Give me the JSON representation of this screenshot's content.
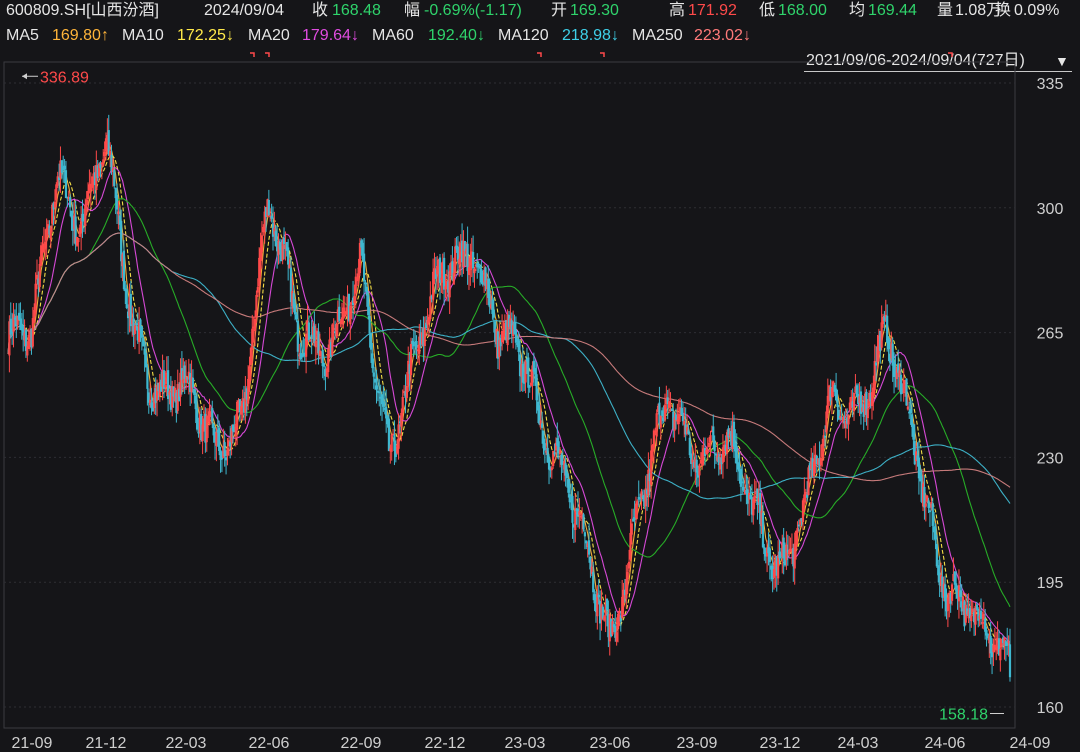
{
  "header": {
    "symbol": "600809.SH[山西汾酒]",
    "date": "2024/09/04",
    "close_label": "收",
    "close_value": "168.48",
    "change_label": "幅",
    "change_value": "-0.69%(-1.17)",
    "open_label": "开",
    "open_value": "169.30",
    "high_label": "高",
    "high_value": "171.92",
    "low_label": "低",
    "low_value": "168.00",
    "avg_label": "均",
    "avg_value": "169.44",
    "vol_label": "量",
    "vol_value": "1.08万",
    "turnover_label": "换",
    "turnover_value": "0.09%"
  },
  "legend": {
    "ma5_label": "MA5",
    "ma5_value": "169.80↑",
    "ma10_label": "MA10",
    "ma10_value": "172.25↓",
    "ma20_label": "MA20",
    "ma20_value": "179.64↓",
    "ma60_label": "MA60",
    "ma60_value": "192.40↓",
    "ma120_label": "MA120",
    "ma120_value": "218.98↓",
    "ma250_label": "MA250",
    "ma250_value": "223.02↓",
    "range_text": "2021/09/06-2024/09/04(727日)",
    "range_dropdown_icon": "triangle-down-icon"
  },
  "colors": {
    "background": "#151518",
    "up": "#ff4a4a",
    "down": "#2fd36b",
    "ma5": "#ffb43a",
    "ma10": "#ffe94a",
    "ma20": "#e04ce0",
    "ma60": "#28b428",
    "ma120": "#3fb8d0",
    "ma250": "#d08080",
    "grid": "#2e2e33",
    "axis_text": "#cfcfcf"
  },
  "chart_data": {
    "type": "candlestick",
    "title": "600809.SH[山西汾酒]",
    "ylim": [
      155,
      340
    ],
    "y_ticks": [
      160,
      195,
      230,
      265,
      300,
      335
    ],
    "x_ticks": [
      "21-09",
      "21-12",
      "22-03",
      "22-06",
      "22-09",
      "22-12",
      "23-03",
      "23-06",
      "23-09",
      "23-12",
      "24-03",
      "24-06",
      "24-09"
    ],
    "max_marker": "336.89",
    "min_marker": "158.18",
    "price_path": [
      [
        "21-09",
        263
      ],
      [
        "21-10",
        312
      ],
      [
        "21-11",
        296
      ],
      [
        "21-12",
        316
      ],
      [
        "22-01",
        268
      ],
      [
        "22-02",
        248
      ],
      [
        "22-03",
        248
      ],
      [
        "22-04",
        235
      ],
      [
        "22-05",
        240
      ],
      [
        "22-06",
        300
      ],
      [
        "22-07",
        268
      ],
      [
        "22-08",
        258
      ],
      [
        "22-09",
        283
      ],
      [
        "22-10",
        232
      ],
      [
        "22-11",
        258
      ],
      [
        "22-12",
        285
      ],
      [
        "23-01",
        290
      ],
      [
        "23-02",
        262
      ],
      [
        "23-03",
        258
      ],
      [
        "23-04",
        232
      ],
      [
        "23-05",
        208
      ],
      [
        "23-06",
        180
      ],
      [
        "23-07",
        215
      ],
      [
        "23-08",
        245
      ],
      [
        "23-09",
        232
      ],
      [
        "23-10",
        235
      ],
      [
        "23-11",
        215
      ],
      [
        "23-12",
        200
      ],
      [
        "24-01",
        215
      ],
      [
        "24-02",
        246
      ],
      [
        "24-03",
        245
      ],
      [
        "24-04",
        263
      ],
      [
        "24-05",
        232
      ],
      [
        "24-06",
        195
      ],
      [
        "24-07",
        183
      ],
      [
        "24-08",
        178
      ],
      [
        "24-09",
        168
      ]
    ],
    "series": [
      {
        "name": "MA5",
        "last": 169.8
      },
      {
        "name": "MA10",
        "last": 172.25
      },
      {
        "name": "MA20",
        "last": 179.64
      },
      {
        "name": "MA60",
        "last": 192.4
      },
      {
        "name": "MA120",
        "last": 218.98
      },
      {
        "name": "MA250",
        "last": 223.02
      }
    ],
    "last_bar": {
      "date": "2024/09/04",
      "open": 169.3,
      "high": 171.92,
      "low": 168.0,
      "close": 168.48
    },
    "grid": true
  }
}
